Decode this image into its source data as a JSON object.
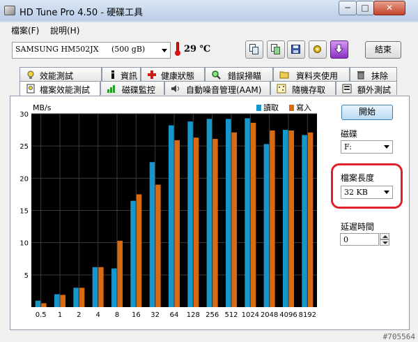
{
  "window": {
    "title": "HD Tune Pro 4.50 - 硬碟工具",
    "minimize_label": "─",
    "maximize_label": "□",
    "close_label": "✕"
  },
  "menu": [
    "檔案(F)",
    "說明(H)"
  ],
  "toolbar": {
    "drive_model": "SAMSUNG HM502JX",
    "drive_capacity": "(500 gB)",
    "temperature": "29 ℃",
    "exit_label": "結束"
  },
  "tabs_row1": [
    {
      "label": "效能測試",
      "icon": "gauge-icon"
    },
    {
      "label": "資訊",
      "icon": "info-icon"
    },
    {
      "label": "健康狀態",
      "icon": "health-icon"
    },
    {
      "label": "錯誤掃瞄",
      "icon": "magnifier-icon"
    },
    {
      "label": "資料夾使用",
      "icon": "folder-icon"
    },
    {
      "label": "抹除",
      "icon": "trash-icon"
    }
  ],
  "tabs_row2": [
    {
      "label": "檔案效能測試",
      "icon": "file-benchmark-icon",
      "active": true
    },
    {
      "label": "磁碟監控",
      "icon": "monitor-chart-icon"
    },
    {
      "label": "自動噪音管理(AAM)",
      "icon": "speaker-icon"
    },
    {
      "label": "隨機存取",
      "icon": "random-access-icon"
    },
    {
      "label": "額外測試",
      "icon": "extra-test-icon"
    }
  ],
  "side": {
    "start_label": "開始",
    "disk_label": "磁碟",
    "disk_value": "F:",
    "file_length_label": "檔案長度",
    "file_length_value": "32 KB",
    "delay_label": "延遲時間",
    "delay_value": "0"
  },
  "watermark": "#705564",
  "colors": {
    "read": "#1796cc",
    "write": "#d86a12",
    "plot_bg": "#000000",
    "grid": "#3a3a3a",
    "highlight": "#e0202a"
  },
  "chart_data": {
    "type": "bar",
    "ylabel": "MB/s",
    "ylim": [
      0,
      30
    ],
    "yticks": [
      5,
      10,
      15,
      20,
      25,
      30
    ],
    "categories": [
      "0.5",
      "1",
      "2",
      "4",
      "8",
      "16",
      "32",
      "64",
      "128",
      "256",
      "512",
      "1024",
      "2048",
      "4096",
      "8192"
    ],
    "series": [
      {
        "name": "讀取",
        "color": "#1796cc",
        "values": [
          1.0,
          2.0,
          3.0,
          6.2,
          6.0,
          16.5,
          22.5,
          28.2,
          28.8,
          29.2,
          29.2,
          29.3,
          25.3,
          27.5,
          26.7
        ]
      },
      {
        "name": "寫入",
        "color": "#d86a12",
        "values": [
          0.6,
          1.9,
          3.0,
          6.2,
          10.3,
          17.5,
          19.0,
          25.9,
          26.3,
          26.1,
          27.1,
          28.6,
          27.4,
          27.4,
          27.1
        ]
      }
    ],
    "grid": true,
    "legend": "top-right"
  }
}
